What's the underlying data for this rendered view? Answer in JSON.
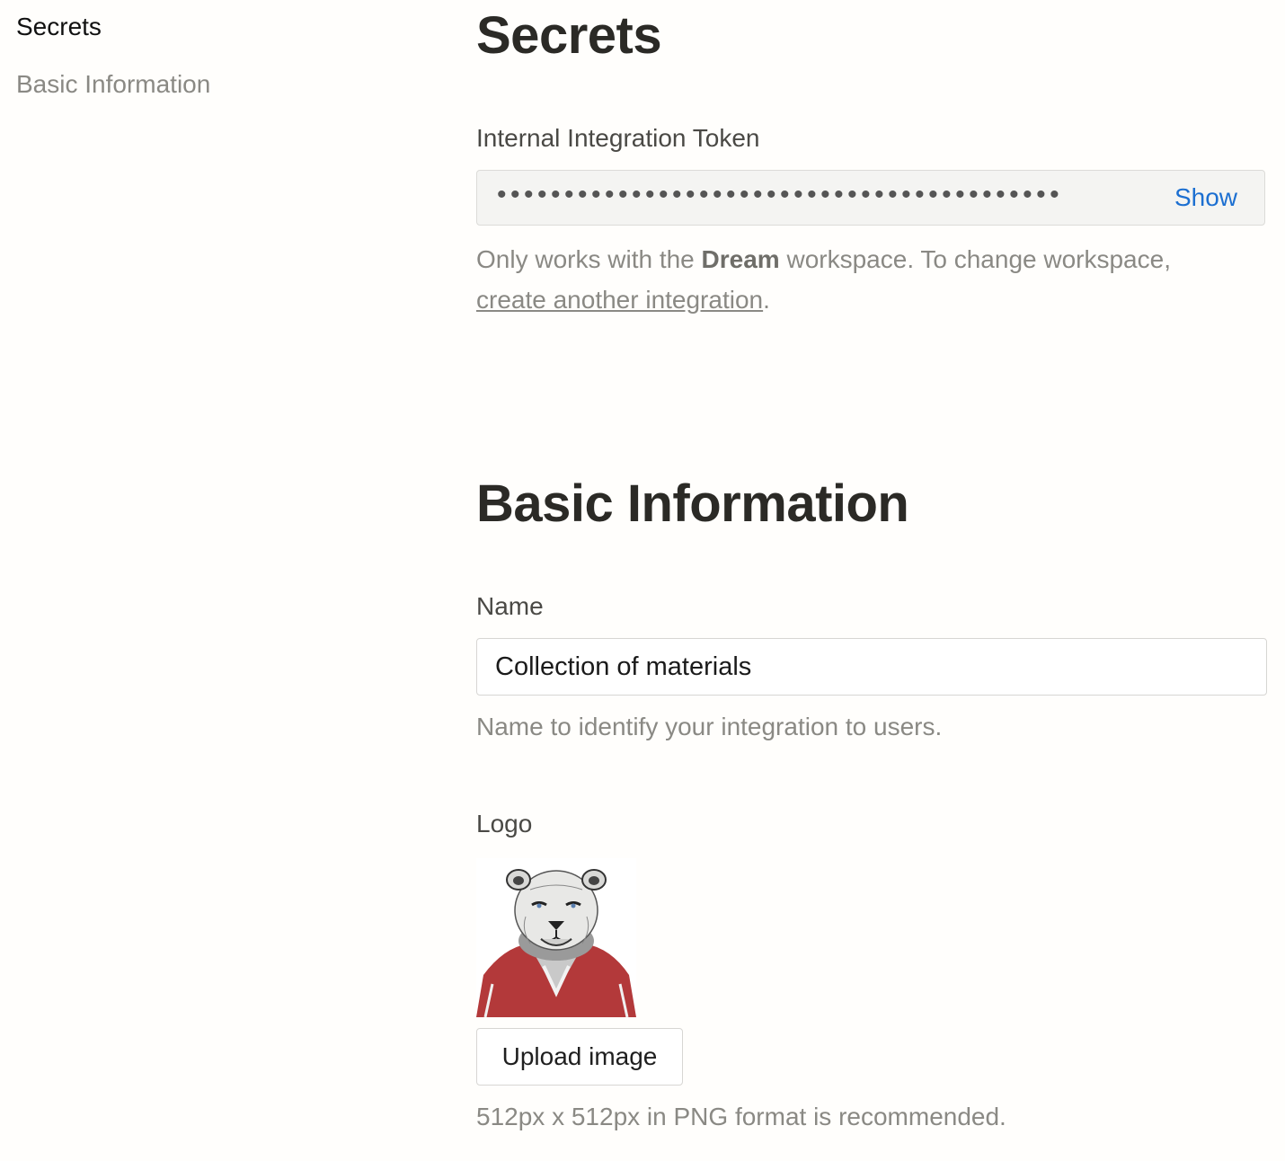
{
  "sidebar": {
    "items": [
      {
        "label": "Secrets",
        "active": true
      },
      {
        "label": "Basic Information",
        "active": false
      }
    ]
  },
  "secrets": {
    "heading": "Secrets",
    "token_label": "Internal Integration Token",
    "token_masked": "••••••••••••••••••••••••••••••••••••••••••",
    "show_label": "Show",
    "help_before": "Only works with the ",
    "help_workspace": "Dream",
    "help_middle": " workspace. To change workspace,",
    "help_link": "create another integration",
    "help_after": "."
  },
  "basic": {
    "heading": "Basic Information",
    "name_label": "Name",
    "name_value": "Collection of materials",
    "name_help": "Name to identify your integration to users.",
    "logo_label": "Logo",
    "upload_label": "Upload image",
    "logo_help": "512px x 512px in PNG format is recommended."
  },
  "colors": {
    "link_blue": "#1c6fd1",
    "jacket_red": "#b3393a"
  }
}
